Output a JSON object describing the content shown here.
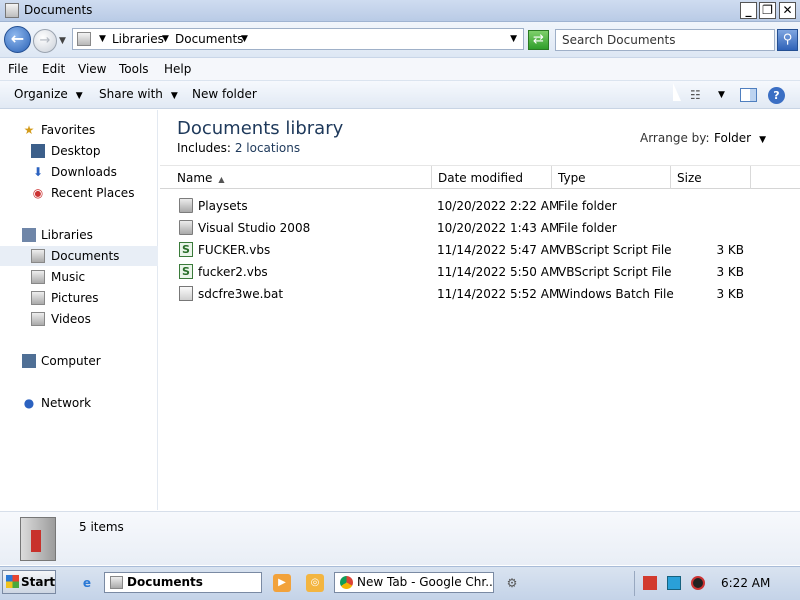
{
  "window": {
    "title": "Documents"
  },
  "titlebar_buttons": {
    "minimize": "_",
    "maximize": "❐",
    "close": "✕"
  },
  "address": {
    "crumbs": [
      "Libraries",
      "Documents"
    ],
    "search_placeholder": "Search Documents"
  },
  "menu": {
    "items": [
      "File",
      "Edit",
      "View",
      "Tools",
      "Help"
    ]
  },
  "toolbar": {
    "organize": "Organize",
    "share_with": "Share with",
    "new_folder": "New folder"
  },
  "navpane": {
    "favorites": {
      "label": "Favorites",
      "items": [
        "Desktop",
        "Downloads",
        "Recent Places"
      ]
    },
    "libraries": {
      "label": "Libraries",
      "items": [
        "Documents",
        "Music",
        "Pictures",
        "Videos"
      ]
    },
    "computer": "Computer",
    "network": "Network",
    "selected": "Documents"
  },
  "library": {
    "title": "Documents library",
    "includes_label": "Includes:",
    "includes_value": "2 locations",
    "arrange_label": "Arrange by:",
    "arrange_value": "Folder"
  },
  "columns": {
    "name": "Name",
    "date": "Date modified",
    "type": "Type",
    "size": "Size"
  },
  "files": [
    {
      "name": "Playsets",
      "date": "10/20/2022 2:22 AM",
      "type": "File folder",
      "size": "",
      "icon": "folder-icon"
    },
    {
      "name": "Visual Studio 2008",
      "date": "10/20/2022 1:43 AM",
      "type": "File folder",
      "size": "",
      "icon": "folder-icon"
    },
    {
      "name": "FUCKER.vbs",
      "date": "11/14/2022 5:47 AM",
      "type": "VBScript Script File",
      "size": "3 KB",
      "icon": "vbscript-file-icon"
    },
    {
      "name": "fucker2.vbs",
      "date": "11/14/2022 5:50 AM",
      "type": "VBScript Script File",
      "size": "3 KB",
      "icon": "vbscript-file-icon"
    },
    {
      "name": "sdcfre3we.bat",
      "date": "11/14/2022 5:52 AM",
      "type": "Windows Batch File",
      "size": "3 KB",
      "icon": "batch-file-icon"
    }
  ],
  "details": {
    "item_count": "5 items"
  },
  "taskbar": {
    "start": "Start",
    "tasks": [
      "Documents",
      "New Tab - Google Chr..."
    ],
    "clock": "6:22 AM"
  },
  "colors": {
    "title_text": "#1e395b",
    "titlebar": "#b9cbe6",
    "selection": "#e8eef6"
  }
}
